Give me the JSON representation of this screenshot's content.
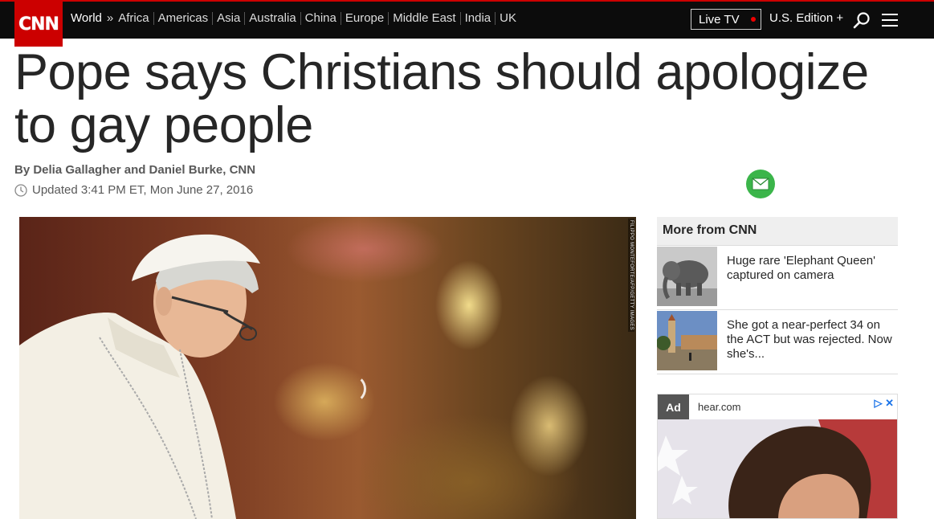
{
  "brand": {
    "logo_text": "CNN",
    "accent": "#cc0000"
  },
  "nav": {
    "section": "World",
    "separator": "»",
    "regions": [
      "Africa",
      "Americas",
      "Asia",
      "Australia",
      "China",
      "Europe",
      "Middle East",
      "India",
      "UK"
    ],
    "live_tv": "Live TV",
    "edition": "U.S. Edition +"
  },
  "article": {
    "headline": "Pope says Christians should apologize to gay people",
    "byline": "By Delia Gallagher and Daniel Burke, CNN",
    "updated": "Updated 3:41 PM ET, Mon June 27, 2016",
    "image_credit": "FILIPPO MONTEFORTE/AFP/GETTY IMAGES"
  },
  "sidebar": {
    "title": "More from CNN",
    "items": [
      {
        "text": "Huge rare 'Elephant Queen' captured on camera",
        "thumb": "elephant"
      },
      {
        "text": "She got a near-perfect 34 on the ACT but was rejected. Now she's...",
        "thumb": "campus-tower"
      }
    ]
  },
  "ad": {
    "badge": "Ad",
    "domain": "hear.com",
    "icons": "▷ ✕"
  },
  "colors": {
    "nav_bg": "#0c0c0c",
    "email_green": "#3bb54a",
    "text_gray": "#595959"
  }
}
